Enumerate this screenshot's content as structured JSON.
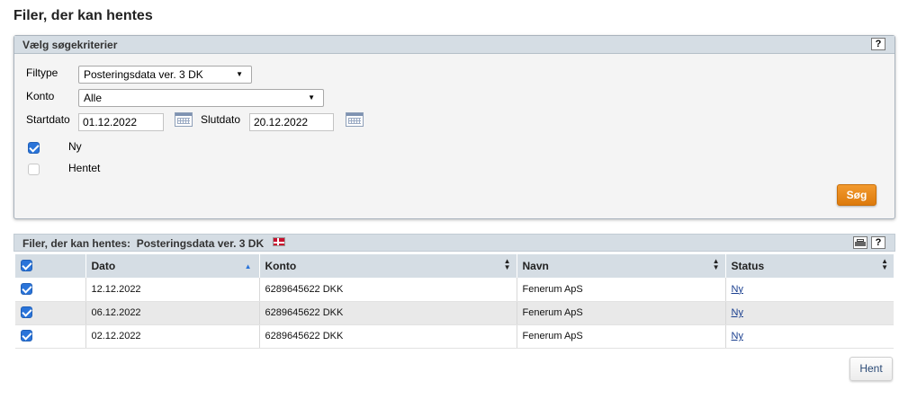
{
  "page": {
    "title": "Filer, der kan hentes"
  },
  "criteria": {
    "header": "Vælg søgekriterier",
    "help_label": "?",
    "filtype_label": "Filtype",
    "filtype_value": "Posteringsdata ver. 3 DK",
    "konto_label": "Konto",
    "konto_value": "Alle",
    "startdato_label": "Startdato",
    "startdato_value": "01.12.2022",
    "slutdato_label": "Slutdato",
    "slutdato_value": "20.12.2022",
    "ny_label": "Ny",
    "ny_checked": true,
    "hentet_label": "Hentet",
    "hentet_checked": false,
    "search_button": "Søg"
  },
  "results": {
    "header_prefix": "Filer, der kan hentes:",
    "header_filetype": "Posteringsdata ver. 3 DK",
    "help_label": "?",
    "columns": [
      "Dato",
      "Konto",
      "Navn",
      "Status"
    ],
    "rows": [
      {
        "dato": "12.12.2022",
        "konto": "6289645622 DKK",
        "navn": "Fenerum ApS",
        "status": "Ny"
      },
      {
        "dato": "06.12.2022",
        "konto": "6289645622 DKK",
        "navn": "Fenerum ApS",
        "status": "Ny"
      },
      {
        "dato": "02.12.2022",
        "konto": "6289645622 DKK",
        "navn": "Fenerum ApS",
        "status": "Ny"
      }
    ],
    "fetch_button": "Hent"
  },
  "colors": {
    "accent_orange": "#e8850f",
    "header_bg": "#d5dde4",
    "checkbox_blue": "#2a74d9",
    "link": "#1a3f8f"
  }
}
